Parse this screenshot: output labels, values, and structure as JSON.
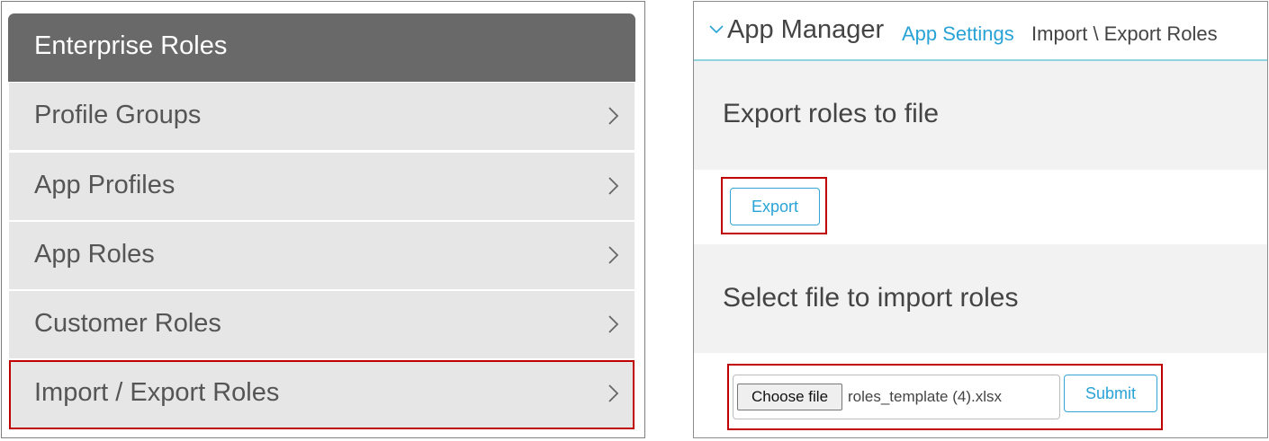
{
  "left_panel": {
    "header_title": "Enterprise Roles",
    "items": [
      {
        "label": "Profile Groups",
        "selected": false
      },
      {
        "label": "App Profiles",
        "selected": false
      },
      {
        "label": "App Roles",
        "selected": false
      },
      {
        "label": "Customer Roles",
        "selected": false
      },
      {
        "label": "Import / Export Roles",
        "selected": true
      }
    ]
  },
  "right_panel": {
    "breadcrumb": {
      "app": "App Manager",
      "settings_link": "App Settings",
      "current": "Import \\ Export Roles"
    },
    "export_section": {
      "title": "Export roles to file",
      "button_label": "Export"
    },
    "import_section": {
      "title": "Select file to import roles",
      "choose_file_label": "Choose file",
      "selected_file": "roles_template (4).xlsx",
      "submit_label": "Submit"
    }
  },
  "colors": {
    "header_bg": "#696969",
    "item_bg": "#e6e6e6",
    "highlight": "#c00000",
    "accent": "#29a3d6",
    "section_bg": "#f2f2f2"
  },
  "icons": {
    "menu_item": "chevron-right-icon",
    "breadcrumb": "chevron-down-icon"
  }
}
